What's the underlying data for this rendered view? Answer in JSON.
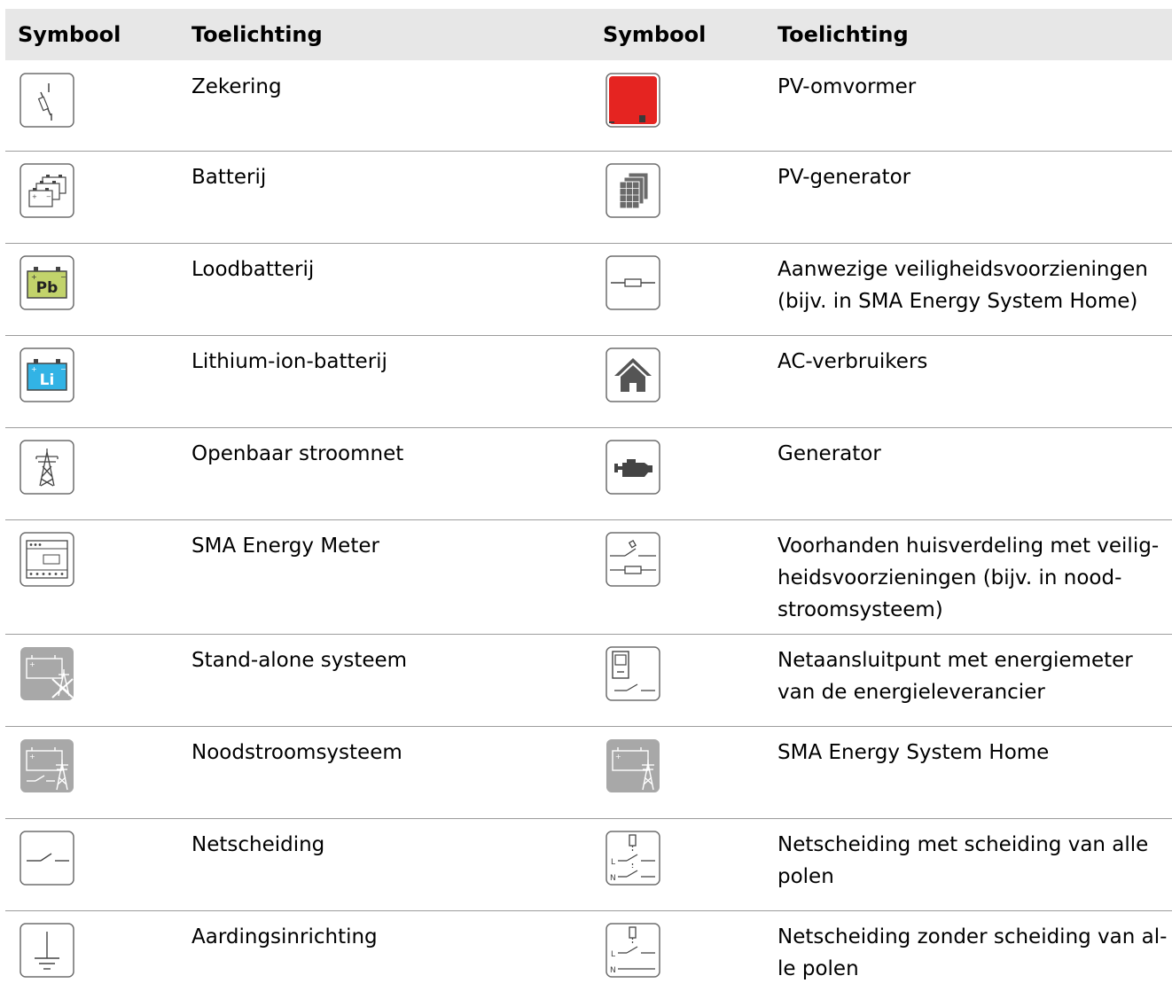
{
  "header": {
    "symbol1": "Symbool",
    "expl1": "Toelichting",
    "symbol2": "Symbool",
    "expl2": "Toelichting"
  },
  "rows": [
    {
      "left": {
        "icon": "fuse-icon",
        "text": "Zekering"
      },
      "right": {
        "icon": "pv-inverter-icon",
        "text": "PV-omvormer"
      }
    },
    {
      "left": {
        "icon": "battery-icon",
        "text": "Batterij"
      },
      "right": {
        "icon": "pv-generator-icon",
        "text": "PV-generator"
      }
    },
    {
      "left": {
        "icon": "lead-battery-icon",
        "label": "Pb",
        "text": "Loodbatterij"
      },
      "right": {
        "icon": "existing-safety-devices-icon",
        "text": "Aanwezige veiligheidsvoorzieningen (bijv. in SMA Energy System Home)"
      }
    },
    {
      "left": {
        "icon": "lithium-battery-icon",
        "label": "Li",
        "text": "Lithium-ion-batterij"
      },
      "right": {
        "icon": "house-icon",
        "text": "AC-verbruikers"
      }
    },
    {
      "left": {
        "icon": "utility-grid-icon",
        "text": "Openbaar stroomnet"
      },
      "right": {
        "icon": "generator-icon",
        "text": "Generator"
      }
    },
    {
      "left": {
        "icon": "energy-meter-icon",
        "text": "SMA Energy Meter"
      },
      "right": {
        "icon": "distribution-board-icon",
        "text": "Voorhanden huisverdeling met veilig­heidsvoorzieningen (bijv. in nood­stroomsysteem)"
      }
    },
    {
      "left": {
        "icon": "off-grid-system-icon",
        "text": "Stand-alone systeem"
      },
      "right": {
        "icon": "grid-connection-meter-icon",
        "text": "Netaansluitpunt met energiemeter van de energieleverancier"
      }
    },
    {
      "left": {
        "icon": "backup-system-icon",
        "text": "Noodstroomsysteem"
      },
      "right": {
        "icon": "sma-energy-system-home-icon",
        "text": "SMA Energy System Home"
      }
    },
    {
      "left": {
        "icon": "grid-disconnect-icon",
        "text": "Netscheiding"
      },
      "right": {
        "icon": "all-pole-disconnect-icon",
        "label_l": "L",
        "label_n": "N",
        "text": "Netscheiding met scheiding van alle polen"
      }
    },
    {
      "left": {
        "icon": "grounding-icon",
        "text": "Aardingsinrichting"
      },
      "right": {
        "icon": "non-all-pole-disconnect-icon",
        "label_l": "L",
        "label_n": "N",
        "text": "Netscheiding zonder scheiding van al­le polen"
      }
    }
  ],
  "colors": {
    "header_bg": "#e7e7e7",
    "inverter_red": "#e52421",
    "lead_green": "#c2d36b",
    "lithium_blue": "#32b3e5",
    "system_gray": "#a8a8a8",
    "icon_border": "#6f6f6f"
  }
}
